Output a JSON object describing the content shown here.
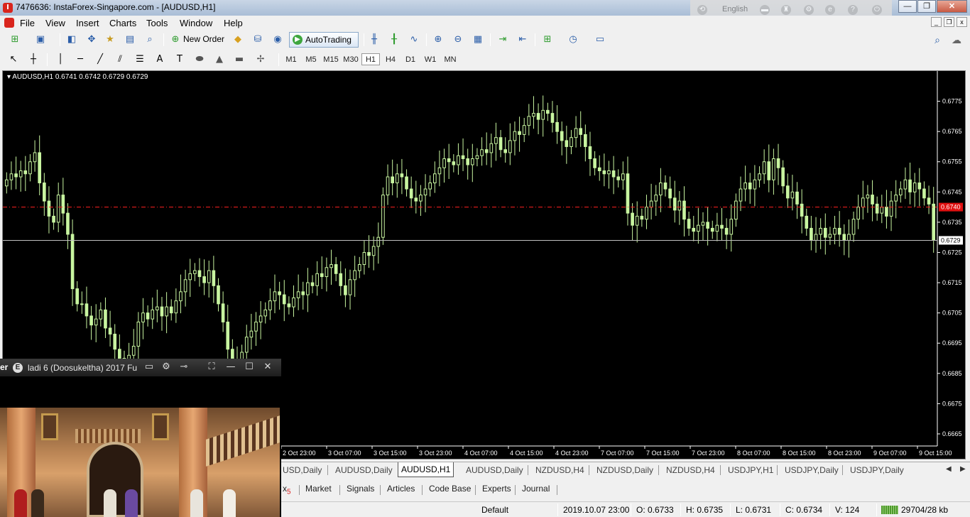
{
  "window": {
    "title": "7476636: InstaForex-Singapore.com - [AUDUSD,H1]",
    "language": "English",
    "minimize": "—",
    "maximize": "❐",
    "close": "✕"
  },
  "menu": [
    "File",
    "View",
    "Insert",
    "Charts",
    "Tools",
    "Window",
    "Help"
  ],
  "toolbar": {
    "new_order": "New Order",
    "auto_trading": "AutoTrading",
    "timeframes": [
      "M1",
      "M5",
      "M15",
      "M30",
      "H1",
      "H4",
      "D1",
      "W1",
      "MN"
    ],
    "active_timeframe": "H1"
  },
  "chart": {
    "symbol_line": "AUDUSD,H1  0.6741 0.6742 0.6729 0.6729",
    "background": "#000000",
    "bull_color": "#c8f5a0",
    "bear_color": "#c8f5a0",
    "bid_line_color": "#ff2020",
    "ask_line_color": "#bfbfbf",
    "bid_label": "0.6740",
    "last_label": "0.6729"
  },
  "chart_data": {
    "type": "candlestick",
    "title": "AUDUSD,H1",
    "ohlc_header": {
      "open": 0.6741,
      "high": 0.6742,
      "low": 0.6729,
      "close": 0.6729
    },
    "y_ticks": [
      "0.6775",
      "0.6765",
      "0.6755",
      "0.6745",
      "0.6735",
      "0.6725",
      "0.6715",
      "0.6705",
      "0.6695",
      "0.6685",
      "0.6675",
      "0.6665"
    ],
    "ylim": [
      0.6661,
      0.6785
    ],
    "x_ticks": [
      "2 Oct 23:00",
      "3 Oct 07:00",
      "3 Oct 15:00",
      "3 Oct 23:00",
      "4 Oct 07:00",
      "4 Oct 15:00",
      "4 Oct 23:00",
      "7 Oct 07:00",
      "7 Oct 15:00",
      "7 Oct 23:00",
      "8 Oct 07:00",
      "8 Oct 15:00",
      "8 Oct 23:00",
      "9 Oct 07:00",
      "9 Oct 15:00"
    ],
    "bid_price": 0.674,
    "last_price": 0.6729,
    "closes": [
      0.6749,
      0.6751,
      0.675,
      0.6752,
      0.6751,
      0.6755,
      0.6758,
      0.6748,
      0.6742,
      0.6737,
      0.6735,
      0.6744,
      0.6738,
      0.6731,
      0.6713,
      0.6708,
      0.6708,
      0.6704,
      0.6701,
      0.6703,
      0.6706,
      0.67,
      0.6698,
      0.6693,
      0.669,
      0.6688,
      0.6691,
      0.6694,
      0.6702,
      0.6705,
      0.6703,
      0.6706,
      0.6707,
      0.6704,
      0.6707,
      0.6705,
      0.6709,
      0.6712,
      0.6716,
      0.6718,
      0.6719,
      0.6717,
      0.6715,
      0.6719,
      0.6714,
      0.6708,
      0.6702,
      0.6693,
      0.6689,
      0.6687,
      0.6692,
      0.6697,
      0.6699,
      0.6702,
      0.6704,
      0.6706,
      0.6709,
      0.6712,
      0.6711,
      0.6708,
      0.6707,
      0.671,
      0.6712,
      0.6711,
      0.6715,
      0.6714,
      0.6718,
      0.6717,
      0.672,
      0.6721,
      0.6718,
      0.6714,
      0.6711,
      0.6716,
      0.6719,
      0.6721,
      0.6725,
      0.6724,
      0.6727,
      0.673,
      0.6744,
      0.675,
      0.6748,
      0.6751,
      0.675,
      0.6746,
      0.6743,
      0.6742,
      0.6744,
      0.6746,
      0.6748,
      0.6751,
      0.6753,
      0.6756,
      0.6755,
      0.6754,
      0.6757,
      0.6756,
      0.6754,
      0.6756,
      0.6757,
      0.6759,
      0.6758,
      0.6761,
      0.6763,
      0.6759,
      0.6758,
      0.6762,
      0.6765,
      0.6764,
      0.6767,
      0.677,
      0.6771,
      0.6769,
      0.6772,
      0.6771,
      0.6768,
      0.6765,
      0.6762,
      0.676,
      0.6763,
      0.6766,
      0.6764,
      0.676,
      0.6756,
      0.6753,
      0.6752,
      0.6751,
      0.6752,
      0.675,
      0.6749,
      0.6751,
      0.6738,
      0.6734,
      0.6737,
      0.6736,
      0.674,
      0.6742,
      0.6744,
      0.6748,
      0.6746,
      0.6743,
      0.6739,
      0.6742,
      0.6736,
      0.6733,
      0.6732,
      0.6734,
      0.6735,
      0.6733,
      0.6732,
      0.6734,
      0.6733,
      0.6731,
      0.6736,
      0.6742,
      0.6746,
      0.6748,
      0.6746,
      0.6749,
      0.6751,
      0.6755,
      0.6749,
      0.6756,
      0.6753,
      0.6747,
      0.6743,
      0.6745,
      0.6741,
      0.6737,
      0.6733,
      0.6729,
      0.6731,
      0.6733,
      0.673,
      0.6731,
      0.6733,
      0.6731,
      0.6729,
      0.6731,
      0.6736,
      0.674,
      0.6743,
      0.6744,
      0.6741,
      0.6738,
      0.674,
      0.6737,
      0.6742,
      0.6744,
      0.6746,
      0.6749,
      0.6745,
      0.6748,
      0.6746,
      0.6743,
      0.6741,
      0.6729
    ]
  },
  "chart_tabs": [
    "USD,Daily",
    "AUDUSD,Daily",
    "AUDUSD,H1",
    "AUDUSD,Daily",
    "NZDUSD,H4",
    "NZDUSD,Daily",
    "NZDUSD,H4",
    "USDJPY,H1",
    "USDJPY,Daily",
    "USDJPY,Daily"
  ],
  "active_chart_tab": "AUDUSD,H1",
  "bottom_tabs": {
    "partial": "x",
    "partial_sub": "5",
    "items": [
      "Market",
      "Signals",
      "Articles",
      "Code Base",
      "Experts",
      "Journal"
    ]
  },
  "status": {
    "profile": "Default",
    "datetime": "2019.10.07 23:00",
    "open": "O: 0.6733",
    "high": "H: 0.6735",
    "low": "L: 0.6731",
    "close": "C: 0.6734",
    "volume": "V: 124",
    "traffic": "29704/28 kb"
  },
  "player": {
    "name": "er",
    "badge": "E",
    "title": "ladi 6 (Doosukeltha) 2017 Fu"
  }
}
